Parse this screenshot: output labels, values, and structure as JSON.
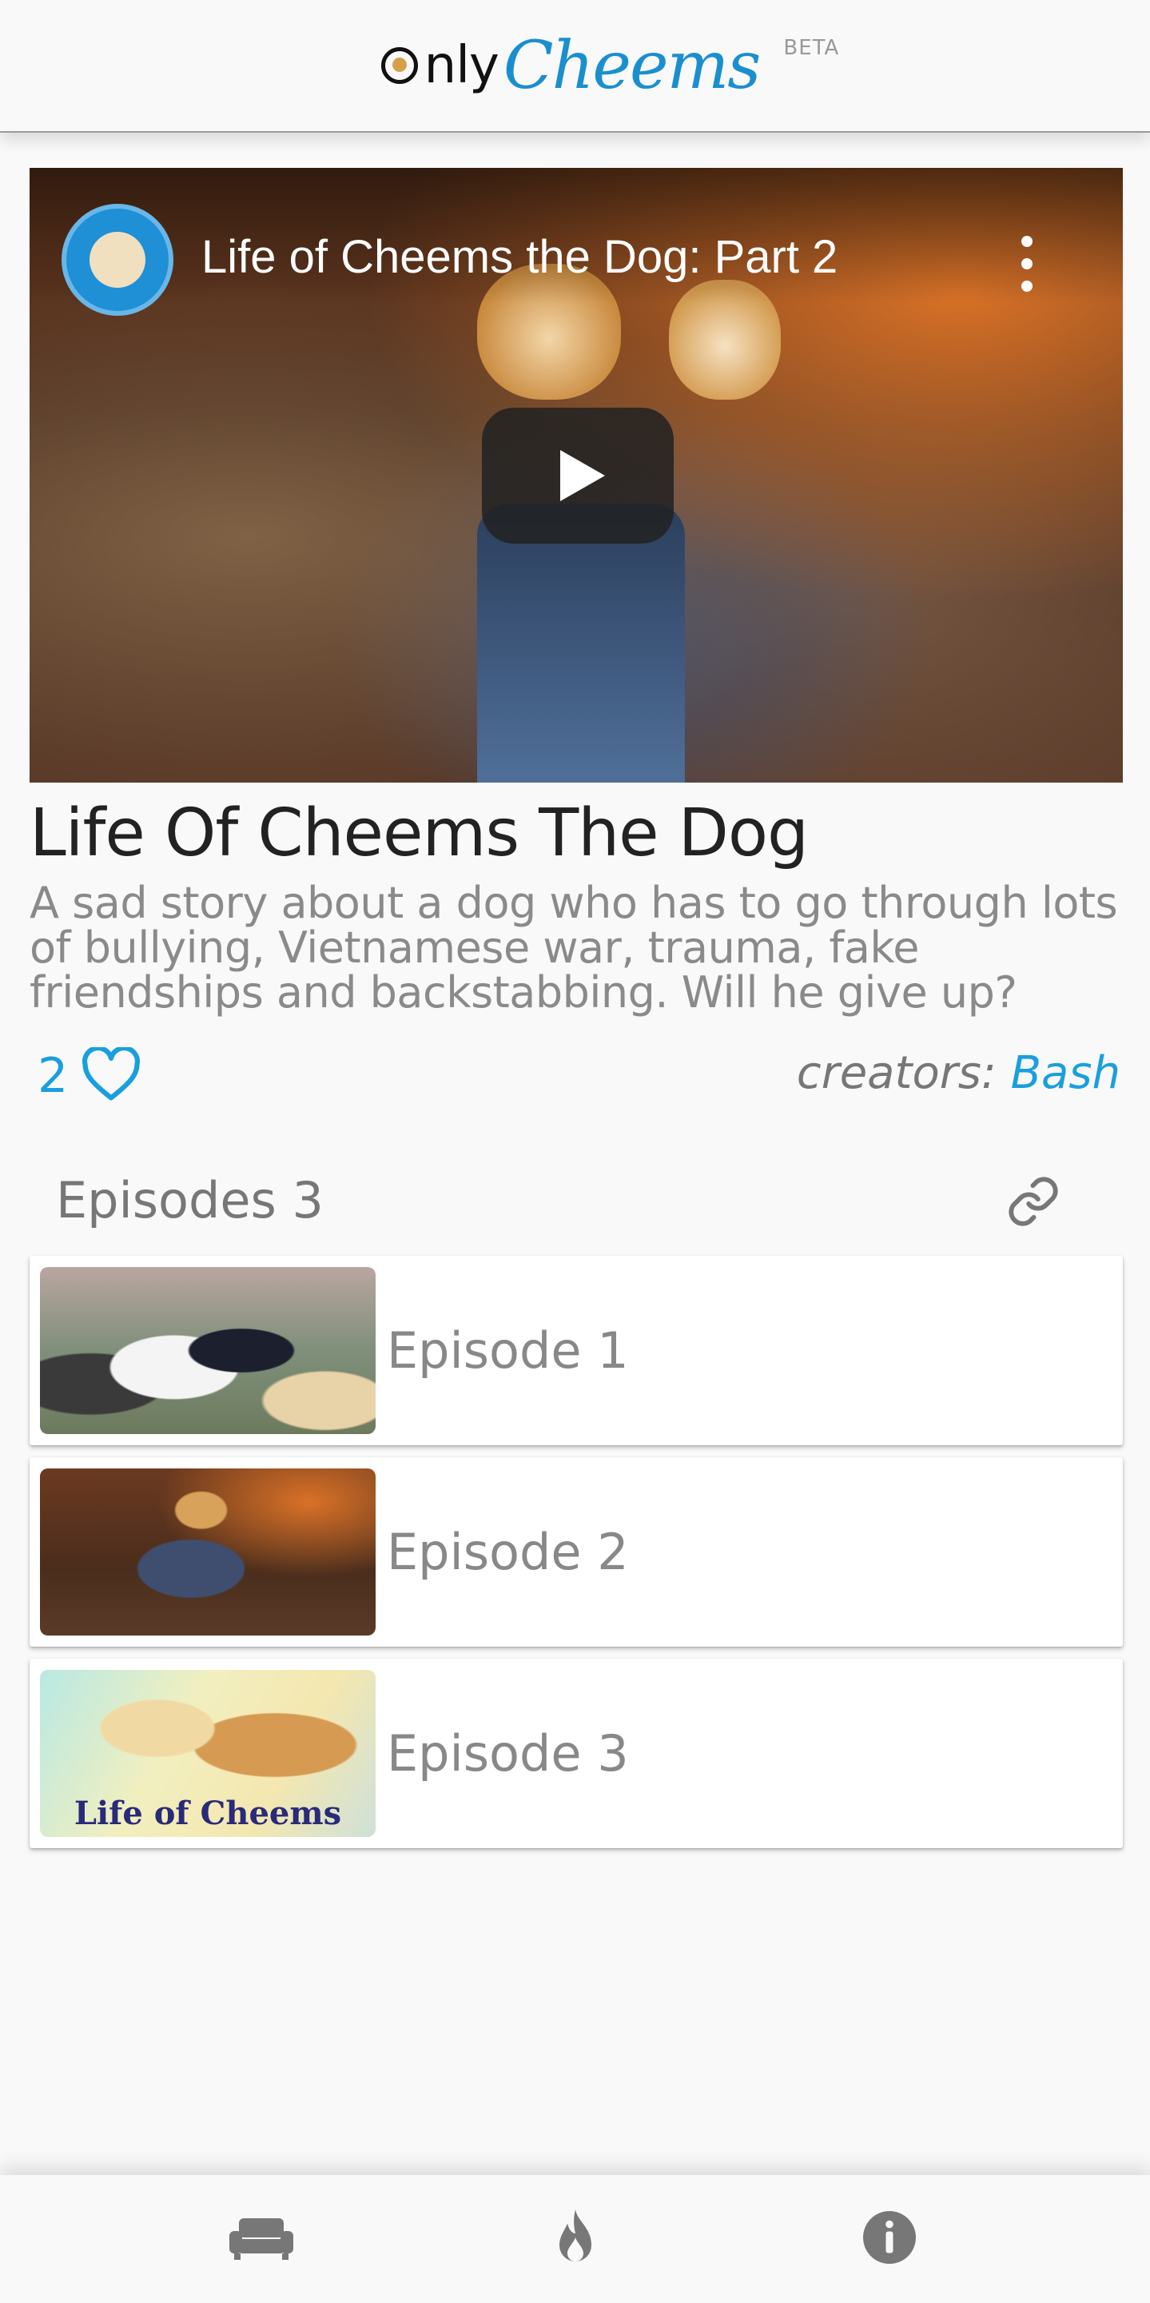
{
  "header": {
    "logo_only": "nly",
    "logo_cheems": "Cheems",
    "beta": "BETA"
  },
  "video": {
    "title": "Life of Cheems the Dog: Part 2"
  },
  "series": {
    "title": "Life Of Cheems The Dog",
    "description": "A sad story about a dog who has to go through lots of bullying, Vietnamese war, trauma, fake friendships and backstabbing. Will he give up?",
    "likes": "2",
    "creators_label": "creators:",
    "creator_name": "Bash"
  },
  "episodes": {
    "heading": "Episodes 3",
    "items": [
      {
        "label": "Episode 1"
      },
      {
        "label": "Episode 2"
      },
      {
        "label": "Episode 3",
        "thumb_caption": "Life of Cheems"
      }
    ]
  },
  "colors": {
    "accent": "#1a9fde",
    "logo_blue": "#1a8fd0",
    "icon_gray": "#777777"
  },
  "nav": {
    "items": [
      {
        "icon": "couch-icon"
      },
      {
        "icon": "fire-icon"
      },
      {
        "icon": "info-icon"
      }
    ]
  }
}
